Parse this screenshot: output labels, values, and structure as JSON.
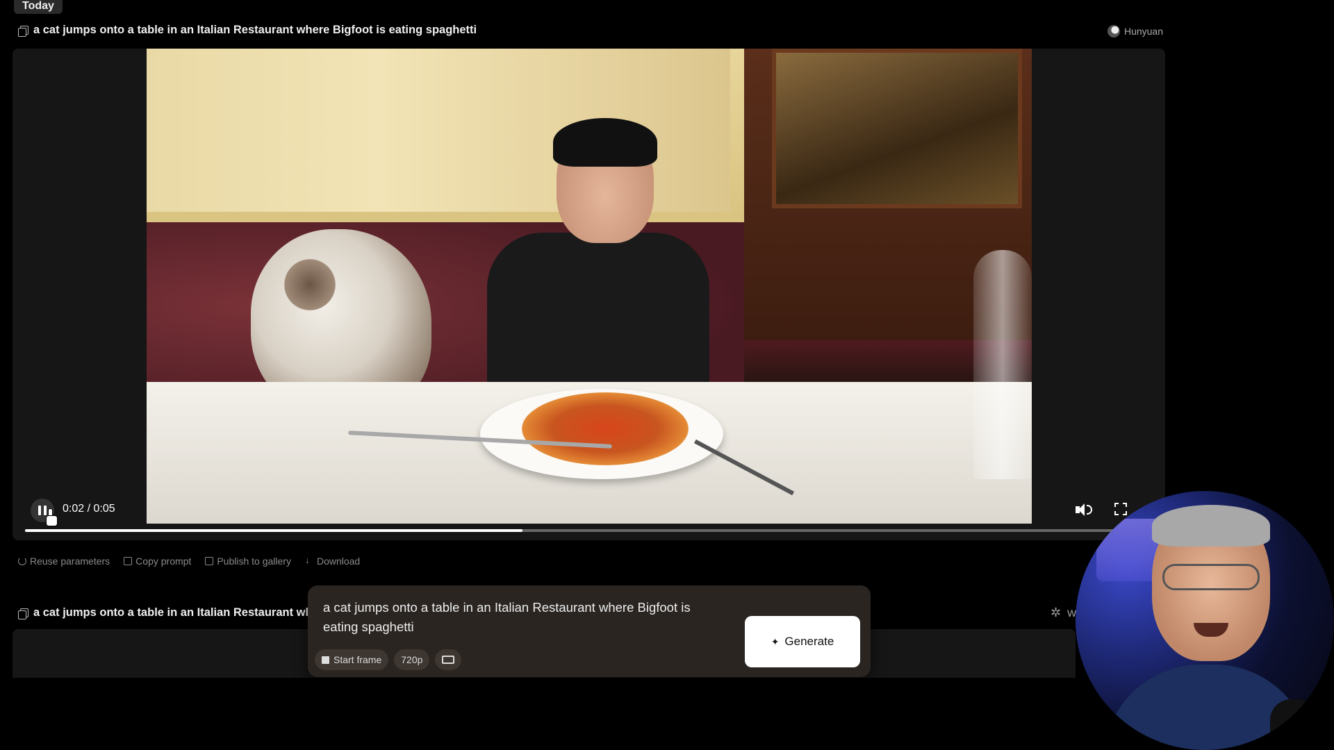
{
  "header": {
    "day_label": "Today"
  },
  "generation_1": {
    "prompt": "a cat jumps onto a table in an Italian Restaurant where Bigfoot is eating spaghetti",
    "model": "Hunyuan",
    "player": {
      "time_display": "0:02 / 0:05",
      "progress_fraction": 0.45,
      "play_state_icon": "pause-icon"
    },
    "actions": [
      {
        "label": "Reuse parameters",
        "icon": "reuse-icon"
      },
      {
        "label": "Copy prompt",
        "icon": "copy-icon"
      },
      {
        "label": "Publish to gallery",
        "icon": "publish-icon"
      },
      {
        "label": "Download",
        "icon": "download-icon"
      }
    ]
  },
  "generation_2": {
    "prompt_truncated": "a cat jumps onto a table in an Italian Restaurant wher",
    "model_truncated": "W"
  },
  "composer": {
    "prompt_value": "a  cat jumps onto a table in an Italian Restaurant where Bigfoot is eating spaghetti",
    "chips": [
      {
        "label": "Start frame",
        "icon": "image-icon"
      },
      {
        "label": "720p"
      },
      {
        "label": "",
        "icon": "aspect-ratio-icon"
      }
    ],
    "generate_label": "Generate"
  },
  "colors": {
    "accent_button": "#ffffff",
    "composer_bg": "#2a2521",
    "page_bg": "#000000"
  }
}
